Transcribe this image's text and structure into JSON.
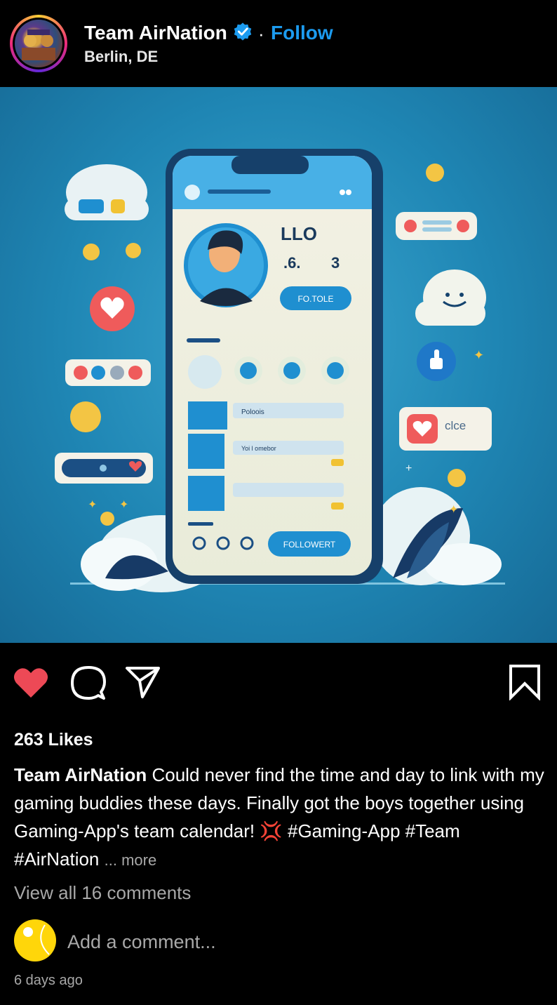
{
  "header": {
    "username": "Team AirNation",
    "verified_icon": "verified-badge-icon",
    "separator": "·",
    "follow_label": "Follow",
    "location": "Berlin, DE"
  },
  "post": {
    "image_labels": {
      "profile_name": "LLO",
      "stat1": ".6.",
      "stat2": "3",
      "profile_button": "FO.TOLE",
      "item1": "Poloois",
      "item2": "Yoi l omebor",
      "follow_button": "FOLLOWERT",
      "side_card": "clce"
    }
  },
  "actions": {
    "like_icon": "heart-icon",
    "comment_icon": "comment-icon",
    "share_icon": "send-icon",
    "save_icon": "bookmark-icon"
  },
  "likes": "263 Likes",
  "caption": {
    "username": "Team AirNation",
    "text": "Could never find the time and day to link with my gaming buddies these days. Finally got the boys together using Gaming-App's team calendar!",
    "emoji": "💢",
    "hashtags": "#Gaming-App #Team #AirNation",
    "more_label": "... more"
  },
  "view_comments": "View all 16 comments",
  "comment_input": {
    "placeholder": "Add a comment..."
  },
  "timestamp": "6 days ago",
  "colors": {
    "accent": "#1c9bef",
    "like": "#ed4956",
    "background": "#000000",
    "muted": "#a8a8a8"
  }
}
